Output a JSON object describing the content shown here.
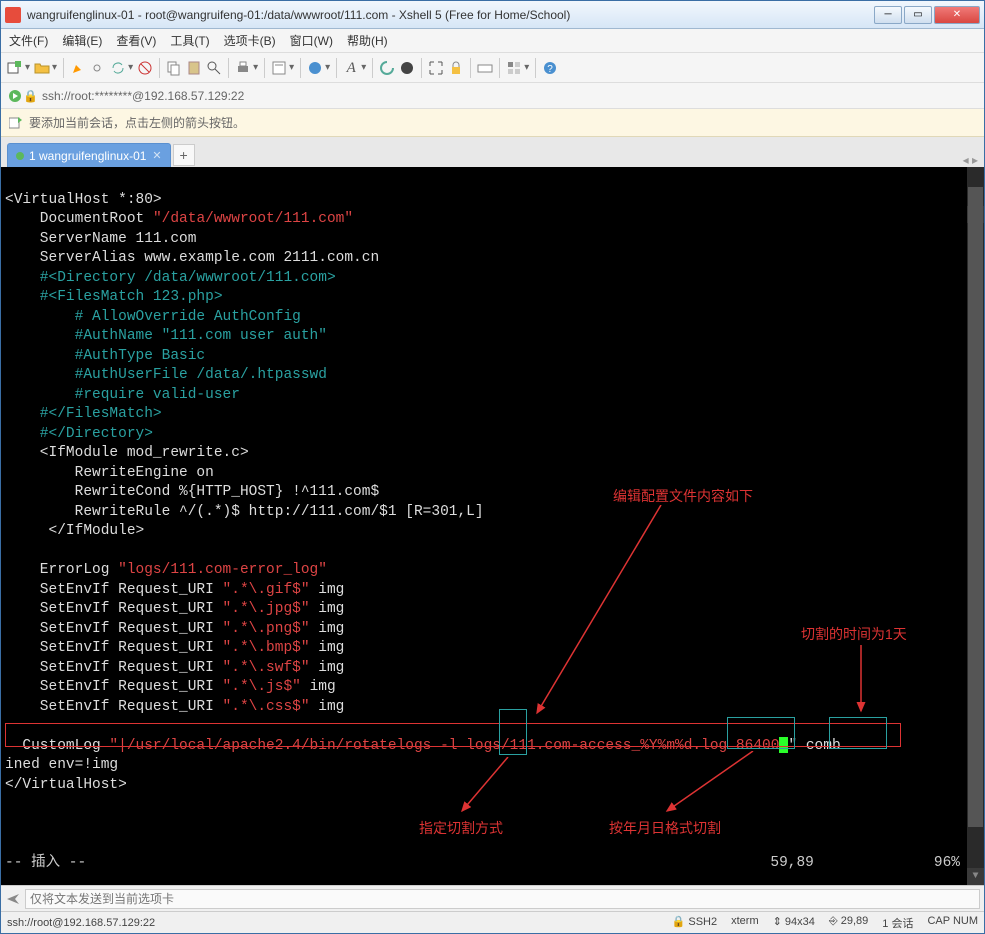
{
  "window": {
    "title": "wangruifenglinux-01 - root@wangruifeng-01:/data/wwwroot/111.com - Xshell 5 (Free for Home/School)"
  },
  "menu": {
    "file": "文件(F)",
    "edit": "编辑(E)",
    "view": "查看(V)",
    "tools": "工具(T)",
    "tabs": "选项卡(B)",
    "window": "窗口(W)",
    "help": "帮助(H)"
  },
  "address": {
    "url": "ssh://root:********@192.168.57.129:22"
  },
  "infobar": {
    "text": "要添加当前会话，点击左侧的箭头按钮。"
  },
  "tab": {
    "label": "1 wangruifenglinux-01"
  },
  "terminal": {
    "line1_a": "<VirtualHost *:80>",
    "line2_a": "    DocumentRoot ",
    "line2_b": "\"/data/wwwroot/111.com\"",
    "line3_a": "    ServerName 111.com",
    "line4_a": "    ServerAlias www.example.com 2111.com.cn",
    "line5_a": "    #<Directory /data/wwwroot/111.com>",
    "line6_a": "    #<FilesMatch 123.php>",
    "line7_a": "        # AllowOverride AuthConfig",
    "line8_a": "        #AuthName \"111.com user auth\"",
    "line9_a": "        #AuthType Basic",
    "line10_a": "        #AuthUserFile /data/.htpasswd",
    "line11_a": "        #require valid-user",
    "line12_a": "    #</FilesMatch>",
    "line13_a": "    #</Directory>",
    "line14_a": "    <IfModule mod_rewrite.c>",
    "line15_a": "        RewriteEngine on",
    "line16_a": "        RewriteCond %{HTTP_HOST} !^111.com$",
    "line17_a": "        RewriteRule ^/(.*)$ http://111.com/$1 [R=301,L]",
    "line18_a": "     </IfModule>",
    "line19_a": "",
    "line20_a": "    ErrorLog ",
    "line20_b": "\"logs/111.com-error_log\"",
    "line21_a": "    SetEnvIf Request_URI ",
    "line21_b": "\".*\\.gif$\"",
    "line21_c": " img",
    "line22_a": "    SetEnvIf Request_URI ",
    "line22_b": "\".*\\.jpg$\"",
    "line22_c": " img",
    "line23_a": "    SetEnvIf Request_URI ",
    "line23_b": "\".*\\.png$\"",
    "line23_c": " img",
    "line24_a": "    SetEnvIf Request_URI ",
    "line24_b": "\".*\\.bmp$\"",
    "line24_c": " img",
    "line25_a": "    SetEnvIf Request_URI ",
    "line25_b": "\".*\\.swf$\"",
    "line25_c": " img",
    "line26_a": "    SetEnvIf Request_URI ",
    "line26_b": "\".*\\.js$\"",
    "line26_c": " img",
    "line27_a": "    SetEnvIf Request_URI ",
    "line27_b": "\".*\\.css$\"",
    "line27_c": " img",
    "line28_a": "",
    "line29_a": "  CustomLog ",
    "line29_b": "\"|/usr/local/apache2.4/bin/rotatelogs -l logs/111.com-access_%Y%m%d.log 86400",
    "line29_c": "\" comb",
    "line30_a": "ined env=!img",
    "line31_a": "</VirtualHost>",
    "vim_mode": "-- 插入 --",
    "vim_pos": "59,89",
    "vim_pct": "96%"
  },
  "annotations": {
    "a1": "编辑配置文件内容如下",
    "a2": "切割的时间为1天",
    "a3": "指定切割方式",
    "a4": "按年月日格式切割"
  },
  "sendbar": {
    "placeholder": "仅将文本发送到当前选项卡"
  },
  "status": {
    "url": "ssh://root@192.168.57.129:22",
    "ssh": "SSH2",
    "term": "xterm",
    "size": "94x34",
    "pos": "29,89",
    "sess": "1 会话",
    "cap": "CAP",
    "num": "NUM"
  }
}
